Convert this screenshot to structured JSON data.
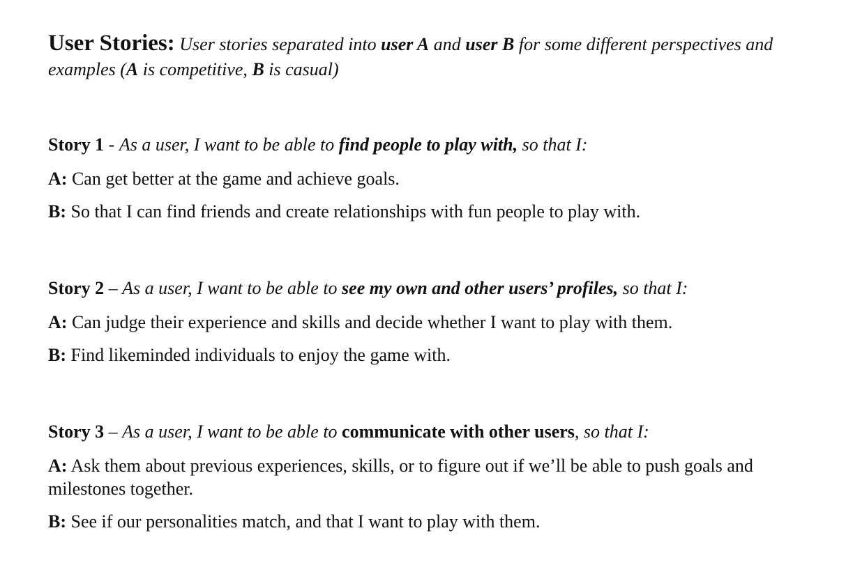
{
  "header": {
    "title": "User Stories:",
    "intro_1": "User stories separated into ",
    "user_a": "user A",
    "intro_2": " and ",
    "user_b": "user B",
    "intro_3": " for some different perspectives and examples (",
    "a": "A",
    "intro_4": " is competitive, ",
    "b": "B",
    "intro_5": " is casual)"
  },
  "stories": [
    {
      "label": "Story 1",
      "separator": " - ",
      "lead": "As a user, I want to be able to ",
      "focus": "find people to play with,",
      "tail": " so that I:",
      "answers": [
        {
          "key": "A:",
          "text": " Can get better at the game and achieve goals."
        },
        {
          "key": "B:",
          "text": " So that I can find friends and create relationships with fun people to play with."
        }
      ]
    },
    {
      "label": "Story 2",
      "separator": " – ",
      "lead": "As a user, I want to be able to ",
      "focus": "see my own and other users’ profiles,",
      "tail": " so that I:",
      "answers": [
        {
          "key": "A:",
          "text": " Can judge their experience and skills and decide whether I want to play with them."
        },
        {
          "key": "B:",
          "text": " Find likeminded individuals to enjoy the game with."
        }
      ]
    },
    {
      "label": "Story 3",
      "separator": " – ",
      "lead": "As a user, I want to be able to ",
      "focus": "communicate with other users",
      "tail": ", so that I:",
      "answers": [
        {
          "key": "A:",
          "text": " Ask them about previous experiences, skills, or to figure out if we’ll be able to push goals and milestones together."
        },
        {
          "key": "B:",
          "text": " See if our personalities match, and that I want to play with them."
        }
      ]
    }
  ]
}
